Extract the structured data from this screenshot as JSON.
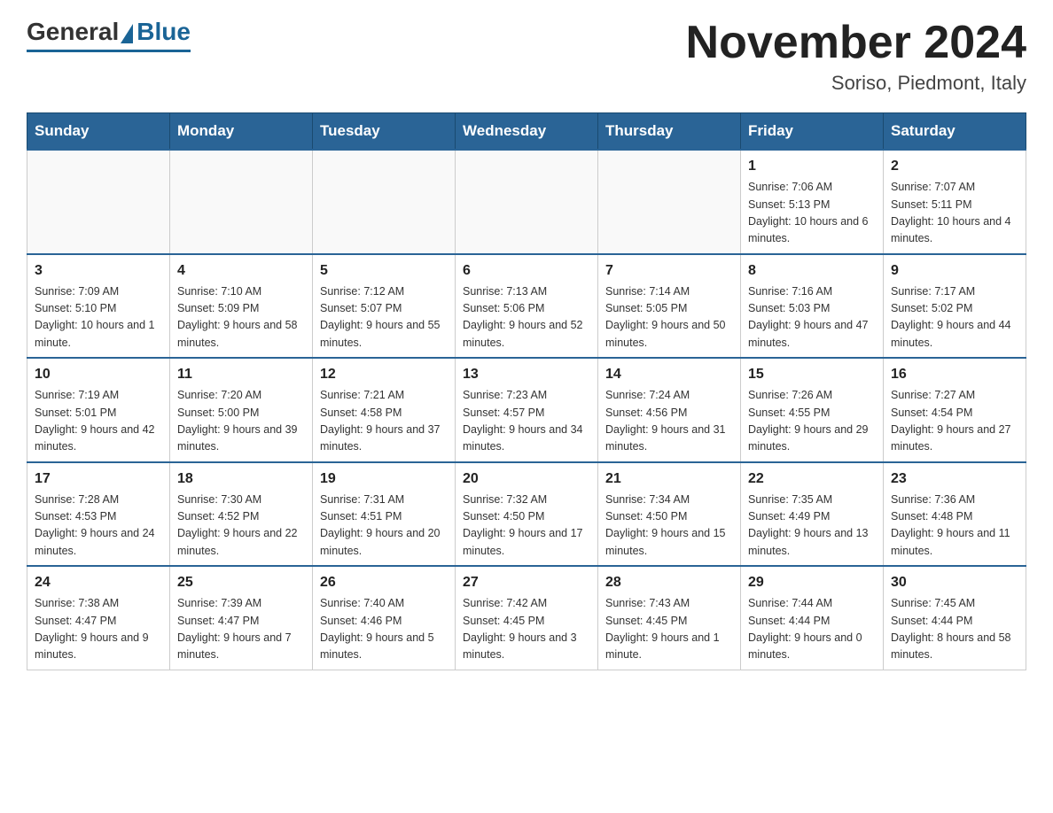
{
  "header": {
    "logo_general": "General",
    "logo_blue": "Blue",
    "month_title": "November 2024",
    "location": "Soriso, Piedmont, Italy"
  },
  "weekdays": [
    "Sunday",
    "Monday",
    "Tuesday",
    "Wednesday",
    "Thursday",
    "Friday",
    "Saturday"
  ],
  "weeks": [
    [
      {
        "day": "",
        "info": ""
      },
      {
        "day": "",
        "info": ""
      },
      {
        "day": "",
        "info": ""
      },
      {
        "day": "",
        "info": ""
      },
      {
        "day": "",
        "info": ""
      },
      {
        "day": "1",
        "info": "Sunrise: 7:06 AM\nSunset: 5:13 PM\nDaylight: 10 hours and 6 minutes."
      },
      {
        "day": "2",
        "info": "Sunrise: 7:07 AM\nSunset: 5:11 PM\nDaylight: 10 hours and 4 minutes."
      }
    ],
    [
      {
        "day": "3",
        "info": "Sunrise: 7:09 AM\nSunset: 5:10 PM\nDaylight: 10 hours and 1 minute."
      },
      {
        "day": "4",
        "info": "Sunrise: 7:10 AM\nSunset: 5:09 PM\nDaylight: 9 hours and 58 minutes."
      },
      {
        "day": "5",
        "info": "Sunrise: 7:12 AM\nSunset: 5:07 PM\nDaylight: 9 hours and 55 minutes."
      },
      {
        "day": "6",
        "info": "Sunrise: 7:13 AM\nSunset: 5:06 PM\nDaylight: 9 hours and 52 minutes."
      },
      {
        "day": "7",
        "info": "Sunrise: 7:14 AM\nSunset: 5:05 PM\nDaylight: 9 hours and 50 minutes."
      },
      {
        "day": "8",
        "info": "Sunrise: 7:16 AM\nSunset: 5:03 PM\nDaylight: 9 hours and 47 minutes."
      },
      {
        "day": "9",
        "info": "Sunrise: 7:17 AM\nSunset: 5:02 PM\nDaylight: 9 hours and 44 minutes."
      }
    ],
    [
      {
        "day": "10",
        "info": "Sunrise: 7:19 AM\nSunset: 5:01 PM\nDaylight: 9 hours and 42 minutes."
      },
      {
        "day": "11",
        "info": "Sunrise: 7:20 AM\nSunset: 5:00 PM\nDaylight: 9 hours and 39 minutes."
      },
      {
        "day": "12",
        "info": "Sunrise: 7:21 AM\nSunset: 4:58 PM\nDaylight: 9 hours and 37 minutes."
      },
      {
        "day": "13",
        "info": "Sunrise: 7:23 AM\nSunset: 4:57 PM\nDaylight: 9 hours and 34 minutes."
      },
      {
        "day": "14",
        "info": "Sunrise: 7:24 AM\nSunset: 4:56 PM\nDaylight: 9 hours and 31 minutes."
      },
      {
        "day": "15",
        "info": "Sunrise: 7:26 AM\nSunset: 4:55 PM\nDaylight: 9 hours and 29 minutes."
      },
      {
        "day": "16",
        "info": "Sunrise: 7:27 AM\nSunset: 4:54 PM\nDaylight: 9 hours and 27 minutes."
      }
    ],
    [
      {
        "day": "17",
        "info": "Sunrise: 7:28 AM\nSunset: 4:53 PM\nDaylight: 9 hours and 24 minutes."
      },
      {
        "day": "18",
        "info": "Sunrise: 7:30 AM\nSunset: 4:52 PM\nDaylight: 9 hours and 22 minutes."
      },
      {
        "day": "19",
        "info": "Sunrise: 7:31 AM\nSunset: 4:51 PM\nDaylight: 9 hours and 20 minutes."
      },
      {
        "day": "20",
        "info": "Sunrise: 7:32 AM\nSunset: 4:50 PM\nDaylight: 9 hours and 17 minutes."
      },
      {
        "day": "21",
        "info": "Sunrise: 7:34 AM\nSunset: 4:50 PM\nDaylight: 9 hours and 15 minutes."
      },
      {
        "day": "22",
        "info": "Sunrise: 7:35 AM\nSunset: 4:49 PM\nDaylight: 9 hours and 13 minutes."
      },
      {
        "day": "23",
        "info": "Sunrise: 7:36 AM\nSunset: 4:48 PM\nDaylight: 9 hours and 11 minutes."
      }
    ],
    [
      {
        "day": "24",
        "info": "Sunrise: 7:38 AM\nSunset: 4:47 PM\nDaylight: 9 hours and 9 minutes."
      },
      {
        "day": "25",
        "info": "Sunrise: 7:39 AM\nSunset: 4:47 PM\nDaylight: 9 hours and 7 minutes."
      },
      {
        "day": "26",
        "info": "Sunrise: 7:40 AM\nSunset: 4:46 PM\nDaylight: 9 hours and 5 minutes."
      },
      {
        "day": "27",
        "info": "Sunrise: 7:42 AM\nSunset: 4:45 PM\nDaylight: 9 hours and 3 minutes."
      },
      {
        "day": "28",
        "info": "Sunrise: 7:43 AM\nSunset: 4:45 PM\nDaylight: 9 hours and 1 minute."
      },
      {
        "day": "29",
        "info": "Sunrise: 7:44 AM\nSunset: 4:44 PM\nDaylight: 9 hours and 0 minutes."
      },
      {
        "day": "30",
        "info": "Sunrise: 7:45 AM\nSunset: 4:44 PM\nDaylight: 8 hours and 58 minutes."
      }
    ]
  ]
}
